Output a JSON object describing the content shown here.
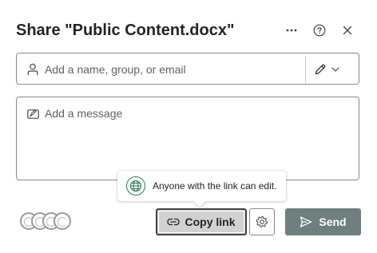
{
  "dialog": {
    "title": "Share \"Public Content.docx\""
  },
  "header_icons": [
    "more-icon",
    "help-icon",
    "close-icon"
  ],
  "people_field": {
    "placeholder": "Add a name, group, or email",
    "value": "",
    "icon": "person-icon",
    "permission_icon": "pencil-icon"
  },
  "message_field": {
    "placeholder": "Add a message",
    "value": "",
    "icon": "message-icon"
  },
  "tooltip": {
    "text": "Anyone with the link can edit.",
    "icon": "globe-icon"
  },
  "footer": {
    "copy_link_label": "Copy link",
    "send_label": "Send"
  },
  "colors": {
    "send_button": "#6f7f7f",
    "copy_link_bg": "#d1d1d1",
    "globe_green": "#2e7d4f"
  }
}
